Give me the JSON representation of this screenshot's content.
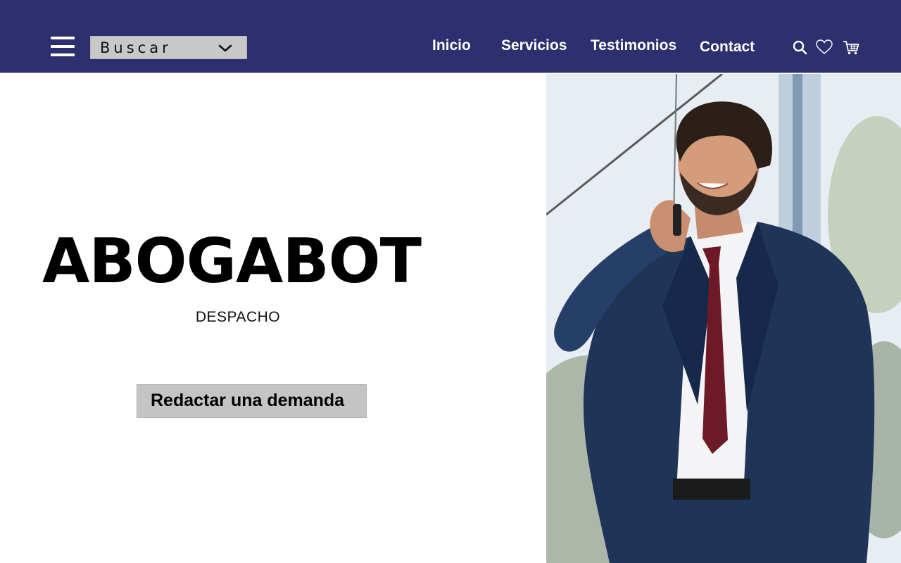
{
  "header": {
    "menu_icon": "hamburger-menu-icon",
    "search": {
      "label": "Buscar",
      "icon": "chevron-down-icon"
    },
    "nav": [
      {
        "label": "Inicio"
      },
      {
        "label": "Servicios"
      },
      {
        "label": "Testimonios"
      },
      {
        "label": "Contact"
      }
    ],
    "icons": [
      "search-icon",
      "heart-icon",
      "cart-icon"
    ]
  },
  "hero": {
    "title": "ABOGABOT",
    "subtitle": "DESPACHO",
    "cta_label": "Redactar una demanda",
    "image": "businessman-on-phone-photo"
  },
  "colors": {
    "header_bg": "#2d2f6e",
    "button_bg": "#c4c4c4",
    "text": "#000000",
    "nav_text": "#ffffff"
  }
}
